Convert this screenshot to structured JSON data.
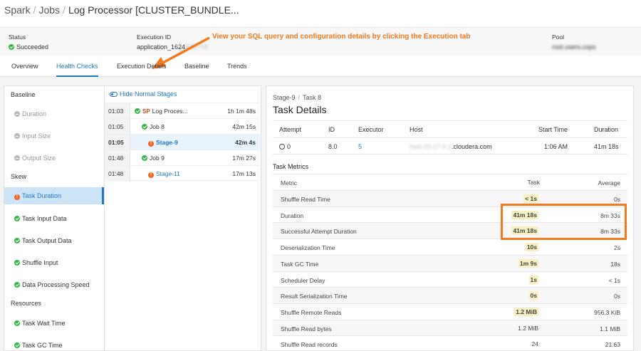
{
  "breadcrumb": {
    "root": "Spark",
    "level2": "Jobs",
    "current": "Log Processor [CLUSTER_BUNDLE..."
  },
  "info": {
    "status_label": "Status",
    "status_value": "Succeeded",
    "exec_label": "Execution ID",
    "exec_value": "application_1624",
    "exec_value_hidden": "593774l",
    "pool_label": "Pool",
    "pool_value": "root.users.cops"
  },
  "callout": "View your SQL query and configuration details by clicking the Execution tab",
  "tabs": [
    "Overview",
    "Health Checks",
    "Execution Details",
    "Baseline",
    "Trends"
  ],
  "active_tab": "Health Checks",
  "left_panel": {
    "baseline_header": "Baseline",
    "baseline_items": [
      "Duration",
      "Input Size",
      "Output Size"
    ],
    "skew_header": "Skew",
    "skew_items": [
      "Task Duration",
      "Task Input Data",
      "Task Output Data",
      "Shuffle Input",
      "Data Processing Speed"
    ],
    "resources_header": "Resources",
    "resources_items": [
      "Task Wait Time",
      "Task GC Time"
    ]
  },
  "stages_panel": {
    "toggle_label": "Hide Normal Stages",
    "rows": [
      {
        "time": "01:03",
        "prefix": "SP",
        "name": "Log Proces...",
        "duration": "1h 1m 48s"
      },
      {
        "time": "01:05",
        "name": "Job 8",
        "duration": "42m 15s"
      },
      {
        "time": "01:05",
        "name": "Stage-9",
        "duration": "42m 4s"
      },
      {
        "time": "01:48",
        "name": "Job 9",
        "duration": "17m 27s"
      },
      {
        "time": "01:48",
        "name": "Stage-11",
        "duration": "17m 13s"
      }
    ]
  },
  "task_panel": {
    "crumb_stage": "Stage-9",
    "crumb_task": "Task 8",
    "title": "Task Details",
    "attempt_headers": [
      "Attempt",
      "ID",
      "Executor",
      "Host",
      "Start Time",
      "Duration"
    ],
    "attempt_row": {
      "attempt": "0",
      "id": "8.0",
      "executor": "5",
      "host_hidden": "host-10-17-0-1",
      "host": ".cloudera.com",
      "start": "1:06 AM",
      "duration": "41m 18s"
    },
    "metrics_title": "Task Metrics",
    "metric_headers": [
      "Metric",
      "Task",
      "Average"
    ],
    "metrics": [
      {
        "name": "Shuffle Read Time",
        "task": "< 1s",
        "avg": "0s",
        "hl": true
      },
      {
        "name": "Duration",
        "task": "41m 18s",
        "avg": "8m 33s",
        "hl": true
      },
      {
        "name": "Successful Attempt Duration",
        "task": "41m 18s",
        "avg": "8m 33s",
        "hl": true
      },
      {
        "name": "Deserialization Time",
        "task": "10s",
        "avg": "2s",
        "hl": true
      },
      {
        "name": "Task GC Time",
        "task": "1m 9s",
        "avg": "18s",
        "hl": true
      },
      {
        "name": "Scheduler Delay",
        "task": "1s",
        "avg": "< 1s",
        "hl": true
      },
      {
        "name": "Result Serialization Time",
        "task": "0s",
        "avg": "0s",
        "hl": true
      },
      {
        "name": "Shuffle Remote Reads",
        "task": "1.2 MiB",
        "avg": "956.3 KiB",
        "hl": true
      },
      {
        "name": "Shuffle Read bytes",
        "task": "1.2 MiB",
        "avg": "1.1 MiB",
        "hl": false
      },
      {
        "name": "Shuffle Read records",
        "task": "24",
        "avg": "21.63",
        "hl": false
      }
    ]
  },
  "colors": {
    "accent": "#1f77c9",
    "annotation": "#f47b20",
    "success": "#3cb44b",
    "warning": "#f26522",
    "highlight": "#f7f0c2"
  }
}
